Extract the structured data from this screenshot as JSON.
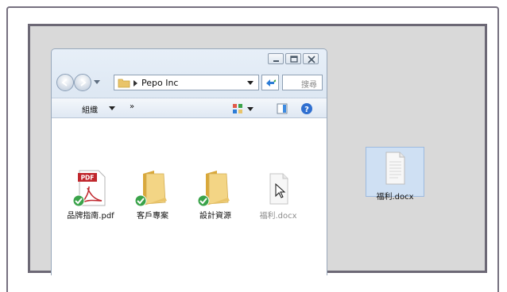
{
  "explorer": {
    "address": {
      "path_label": "Pepo Inc"
    },
    "search": {
      "placeholder": "搜尋"
    },
    "toolbar": {
      "organize_label": "組織",
      "more_label": "»"
    },
    "files": [
      {
        "name": "品牌指南.pdf",
        "type": "pdf",
        "synced": true
      },
      {
        "name": "客戶專案",
        "type": "folder",
        "synced": true
      },
      {
        "name": "設計資源",
        "type": "folder",
        "synced": true
      },
      {
        "name": "福利.docx",
        "type": "document",
        "synced": false,
        "dimmed": true
      }
    ]
  },
  "desktop": {
    "selected_file": {
      "name": "福利.docx",
      "type": "document"
    }
  },
  "colors": {
    "desktop_bg": "#d9d9d9",
    "frame_border": "#6c6875",
    "selection_bg": "#cfe0f3",
    "pdf_red": "#c0272d",
    "sync_green": "#3aa34a"
  }
}
